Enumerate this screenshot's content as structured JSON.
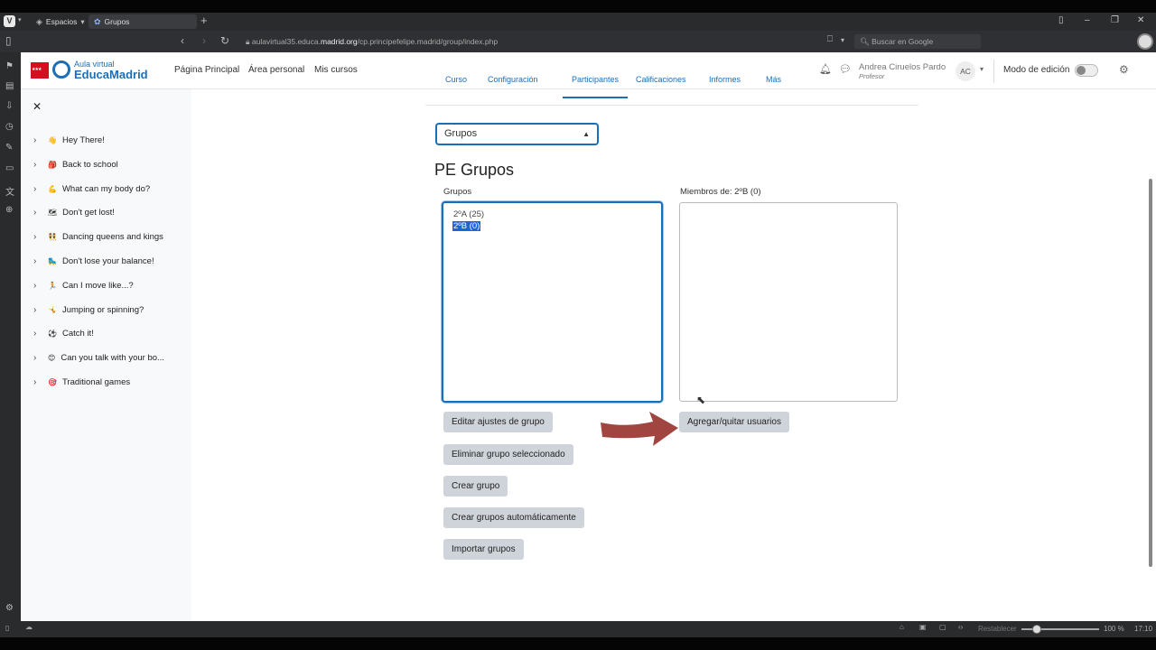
{
  "browser": {
    "logo": "V",
    "spaces_tab": "Espacios",
    "active_tab": "Grupos",
    "url_prefix": "aulavirtual35.educa.",
    "url_domain": "madrid.org",
    "url_suffix": "/cp.principefelipe.madrid/group/index.php",
    "search_placeholder": "Buscar en Google",
    "status_reset": "Restablecer",
    "status_zoom": "100 %",
    "status_time": "17:10"
  },
  "navbar": {
    "logo_small": "Aula virtual",
    "logo_big": "EducaMadrid",
    "links": [
      "Página Principal",
      "Área personal",
      "Mis cursos"
    ],
    "user_name": "Andrea Ciruelos Pardo",
    "user_role": "Profesor",
    "avatar_initials": "AC",
    "edit_mode_label": "Modo de edición"
  },
  "drawer": {
    "items": [
      {
        "emoji": "👋",
        "label": "Hey There!"
      },
      {
        "emoji": "🎒",
        "label": "Back to school"
      },
      {
        "emoji": "💪",
        "label": "What can my body do?"
      },
      {
        "emoji": "🗺",
        "label": "Don't get lost!"
      },
      {
        "emoji": "👯",
        "label": "Dancing queens and kings"
      },
      {
        "emoji": "🛼",
        "label": "Don't lose your balance!"
      },
      {
        "emoji": "🏃",
        "label": "Can I move like...?"
      },
      {
        "emoji": "🤸",
        "label": "Jumping or spinning?"
      },
      {
        "emoji": "⚽",
        "label": "Catch it!"
      },
      {
        "emoji": "😊",
        "label": "Can you talk with your bo..."
      },
      {
        "emoji": "🎯",
        "label": "Traditional games"
      }
    ]
  },
  "subtabs": [
    "Curso",
    "Configuración",
    "Participantes",
    "Calificaciones",
    "Informes",
    "Más"
  ],
  "main": {
    "select_value": "Grupos",
    "heading": "PE Grupos",
    "groups_label": "Grupos",
    "members_label": "Miembros de: 2ºB (0)",
    "groups": [
      {
        "label": "2ºA (25)",
        "selected": false
      },
      {
        "label": "2ºB (0)",
        "selected": true
      }
    ],
    "buttons": {
      "edit": "Editar ajustes de grupo",
      "delete": "Eliminar grupo seleccionado",
      "create": "Crear grupo",
      "auto": "Crear grupos automáticamente",
      "import": "Importar grupos",
      "add_remove": "Agregar/quitar usuarios"
    },
    "arrow_color": "#a0453f",
    "selection_color": "#1e66d4"
  }
}
